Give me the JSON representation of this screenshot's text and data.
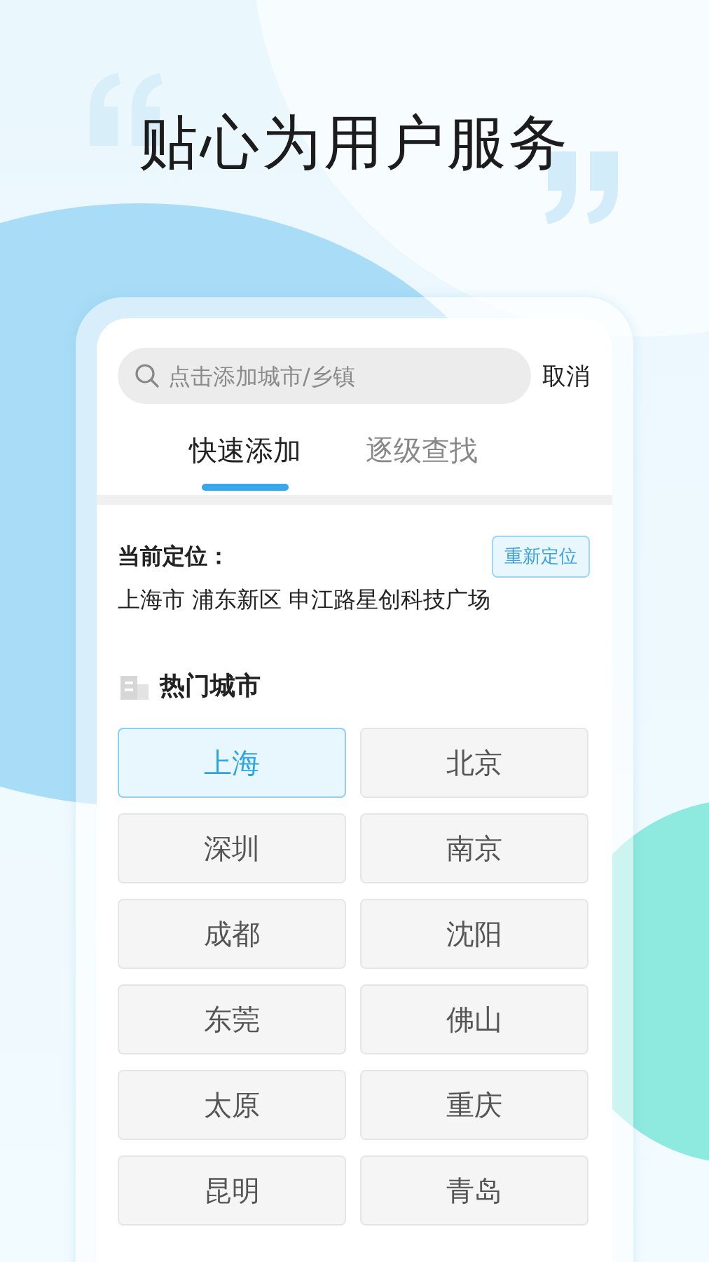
{
  "headline": "贴心为用户服务",
  "search": {
    "placeholder": "点击添加城市/乡镇"
  },
  "cancel": "取消",
  "tabs": [
    {
      "label": "快速添加",
      "selected": true
    },
    {
      "label": "逐级查找",
      "selected": false
    }
  ],
  "location": {
    "label": "当前定位：",
    "relocate": "重新定位",
    "address": "上海市 浦东新区 申江路星创科技广场"
  },
  "hot_cities": {
    "title": "热门城市",
    "cities": [
      {
        "name": "上海",
        "selected": true
      },
      {
        "name": "北京",
        "selected": false
      },
      {
        "name": "深圳",
        "selected": false
      },
      {
        "name": "南京",
        "selected": false
      },
      {
        "name": "成都",
        "selected": false
      },
      {
        "name": "沈阳",
        "selected": false
      },
      {
        "name": "东莞",
        "selected": false
      },
      {
        "name": "佛山",
        "selected": false
      },
      {
        "name": "太原",
        "selected": false
      },
      {
        "name": "重庆",
        "selected": false
      },
      {
        "name": "昆明",
        "selected": false
      },
      {
        "name": "青岛",
        "selected": false
      }
    ]
  }
}
